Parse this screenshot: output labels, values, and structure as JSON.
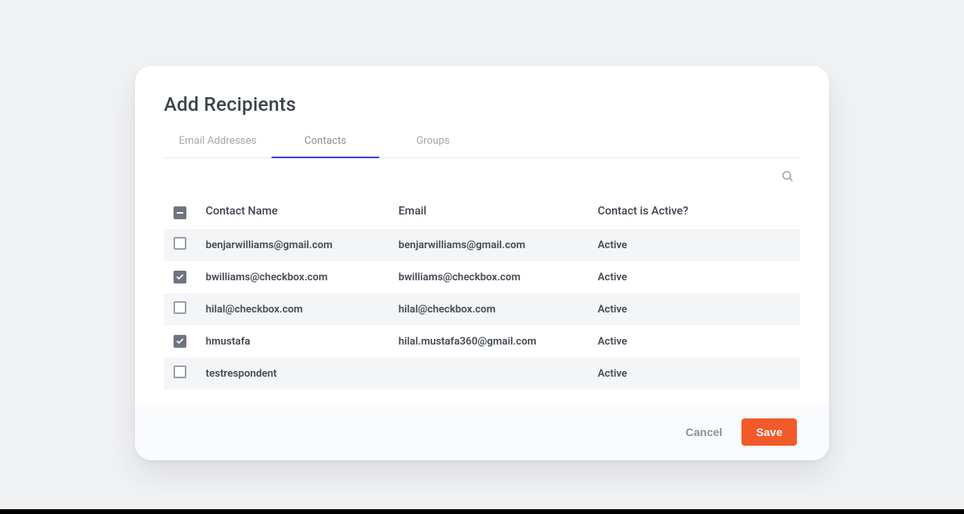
{
  "title": "Add Recipients",
  "tabs": [
    {
      "label": "Email Addresses",
      "active": false
    },
    {
      "label": "Contacts",
      "active": true
    },
    {
      "label": "Groups",
      "active": false
    }
  ],
  "columns": {
    "name": "Contact Name",
    "email": "Email",
    "active": "Contact is Active?"
  },
  "header_checkbox_state": "indeterminate",
  "rows": [
    {
      "checked": false,
      "name": "benjarwilliams@gmail.com",
      "email": "benjarwilliams@gmail.com",
      "active": "Active"
    },
    {
      "checked": true,
      "name": "bwilliams@checkbox.com",
      "email": "bwilliams@checkbox.com",
      "active": "Active"
    },
    {
      "checked": false,
      "name": "hilal@checkbox.com",
      "email": "hilal@checkbox.com",
      "active": "Active"
    },
    {
      "checked": true,
      "name": "hmustafa",
      "email": "hilal.mustafa360@gmail.com",
      "active": "Active"
    },
    {
      "checked": false,
      "name": "testrespondent",
      "email": "",
      "active": "Active"
    }
  ],
  "footer": {
    "cancel": "Cancel",
    "save": "Save"
  }
}
